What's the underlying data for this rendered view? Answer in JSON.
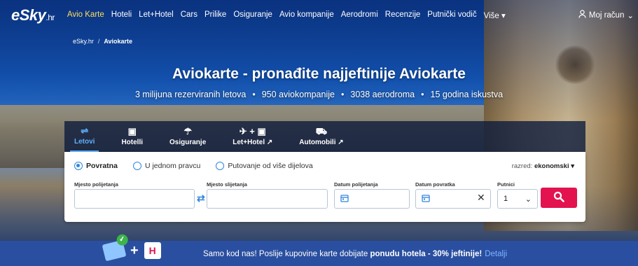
{
  "nav": {
    "logo_main": "eSky",
    "logo_suffix": ".hr",
    "items": [
      {
        "label": "Avio Karte",
        "active": true
      },
      {
        "label": "Hoteli"
      },
      {
        "label": "Let+Hotel"
      },
      {
        "label": "Cars"
      },
      {
        "label": "Prilike"
      },
      {
        "label": "Osiguranje"
      },
      {
        "label": "Avio kompanije"
      },
      {
        "label": "Aerodromi"
      },
      {
        "label": "Recenzije"
      },
      {
        "label": "Putnički vodič"
      },
      {
        "label": "Više ▾"
      }
    ],
    "account_label": "Moj račun",
    "account_icon": "user-icon"
  },
  "breadcrumb": {
    "home": "eSky.hr",
    "separator": "/",
    "current": "Aviokarte"
  },
  "hero": {
    "title": "Aviokarte - pronađite najjeftinije Aviokarte",
    "stats": [
      "3 milijuna rezerviranih letova",
      "950 aviokompanije",
      "3038 aerodroma",
      "15 godina iskustva"
    ],
    "stats_separator": "•"
  },
  "tabs": [
    {
      "label": "Letovi",
      "icon": "flight-icon",
      "glyph": "⇌",
      "active": true
    },
    {
      "label": "Hotelli",
      "icon": "hotel-icon",
      "glyph": "▣"
    },
    {
      "label": "Osiguranje",
      "icon": "umbrella-icon",
      "glyph": "☂"
    },
    {
      "label": "Let+Hotel ↗",
      "icon": "flight-hotel-icon",
      "glyph": "✈ + ▣"
    },
    {
      "label": "Automobili ↗",
      "icon": "car-icon",
      "glyph": "⛟"
    }
  ],
  "search": {
    "trip_types": [
      {
        "label": "Povratna",
        "selected": true
      },
      {
        "label": "U jednom pravcu",
        "selected": false
      },
      {
        "label": "Putovanje od više dijelova",
        "selected": false
      }
    ],
    "cabin_prefix": "razred:",
    "cabin_value": "ekonomski ▾",
    "from_label": "Mjesto polijetanja",
    "from_value": "",
    "to_label": "Mjesto slijetanja",
    "to_value": "",
    "depart_label": "Datum polijetanja",
    "return_label": "Datum povratka",
    "clear_glyph": "✕",
    "passengers_label": "Putnici",
    "passengers_value": "1",
    "passengers_caret": "⌄",
    "search_icon": "search-icon"
  },
  "banner": {
    "text_prefix": "Samo kod nas! Poslije kupovine karte dobijate ",
    "text_bold": "ponudu hotela - 30% jeftinije!",
    "details_link": "Detalji",
    "plus": "+",
    "hotel_letter": "H"
  },
  "colors": {
    "accent_active_nav": "#ffde5a",
    "tab_active": "#5fb0ff",
    "radio_accent": "#2e86de",
    "search_button": "#e2134f",
    "banner_bg": "#2a4fa0"
  }
}
